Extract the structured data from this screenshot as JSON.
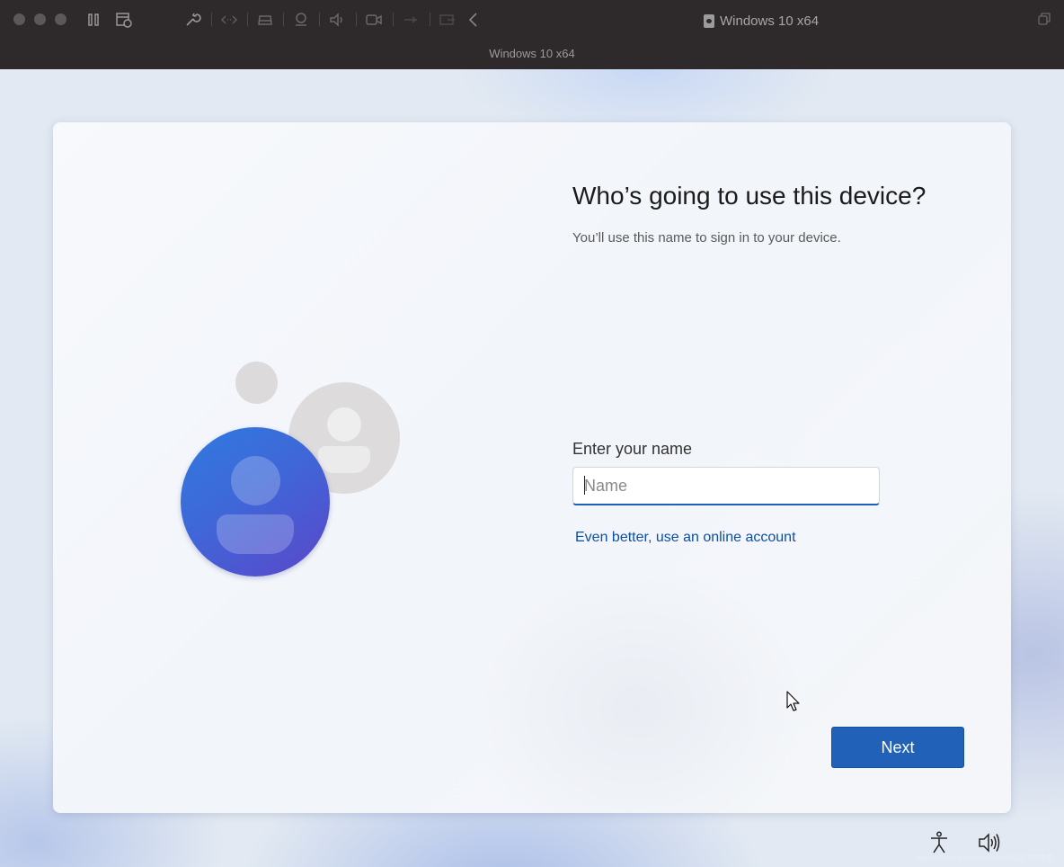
{
  "vm_window": {
    "title": "Windows 10 x64",
    "subtitle": "Windows 10 x64",
    "toolbar_icons": [
      "pause-icon",
      "snapshot-icon",
      "wrench-icon",
      "code-icon",
      "drive-icon",
      "camera-icon",
      "speaker-icon",
      "video-icon",
      "usb-icon",
      "share-icon",
      "back-chevron-icon"
    ]
  },
  "setup": {
    "heading": "Who’s going to use this device?",
    "subheading": "You’ll use this name to sign in to your device.",
    "name_label": "Enter your name",
    "name_placeholder": "Name",
    "name_value": "",
    "online_link": "Even better, use an online account",
    "next_label": "Next"
  },
  "taskbar_icons": [
    "ease-of-access-icon",
    "volume-icon"
  ],
  "watermark": "https://blog.csdn.net/win@51CTO博客",
  "colors": {
    "accent": "#2162b8",
    "link": "#0d4fa3",
    "avatar_gradient": [
      "#2f7ae0",
      "#5b46c9"
    ],
    "titlebar": "#2e2a2c"
  }
}
